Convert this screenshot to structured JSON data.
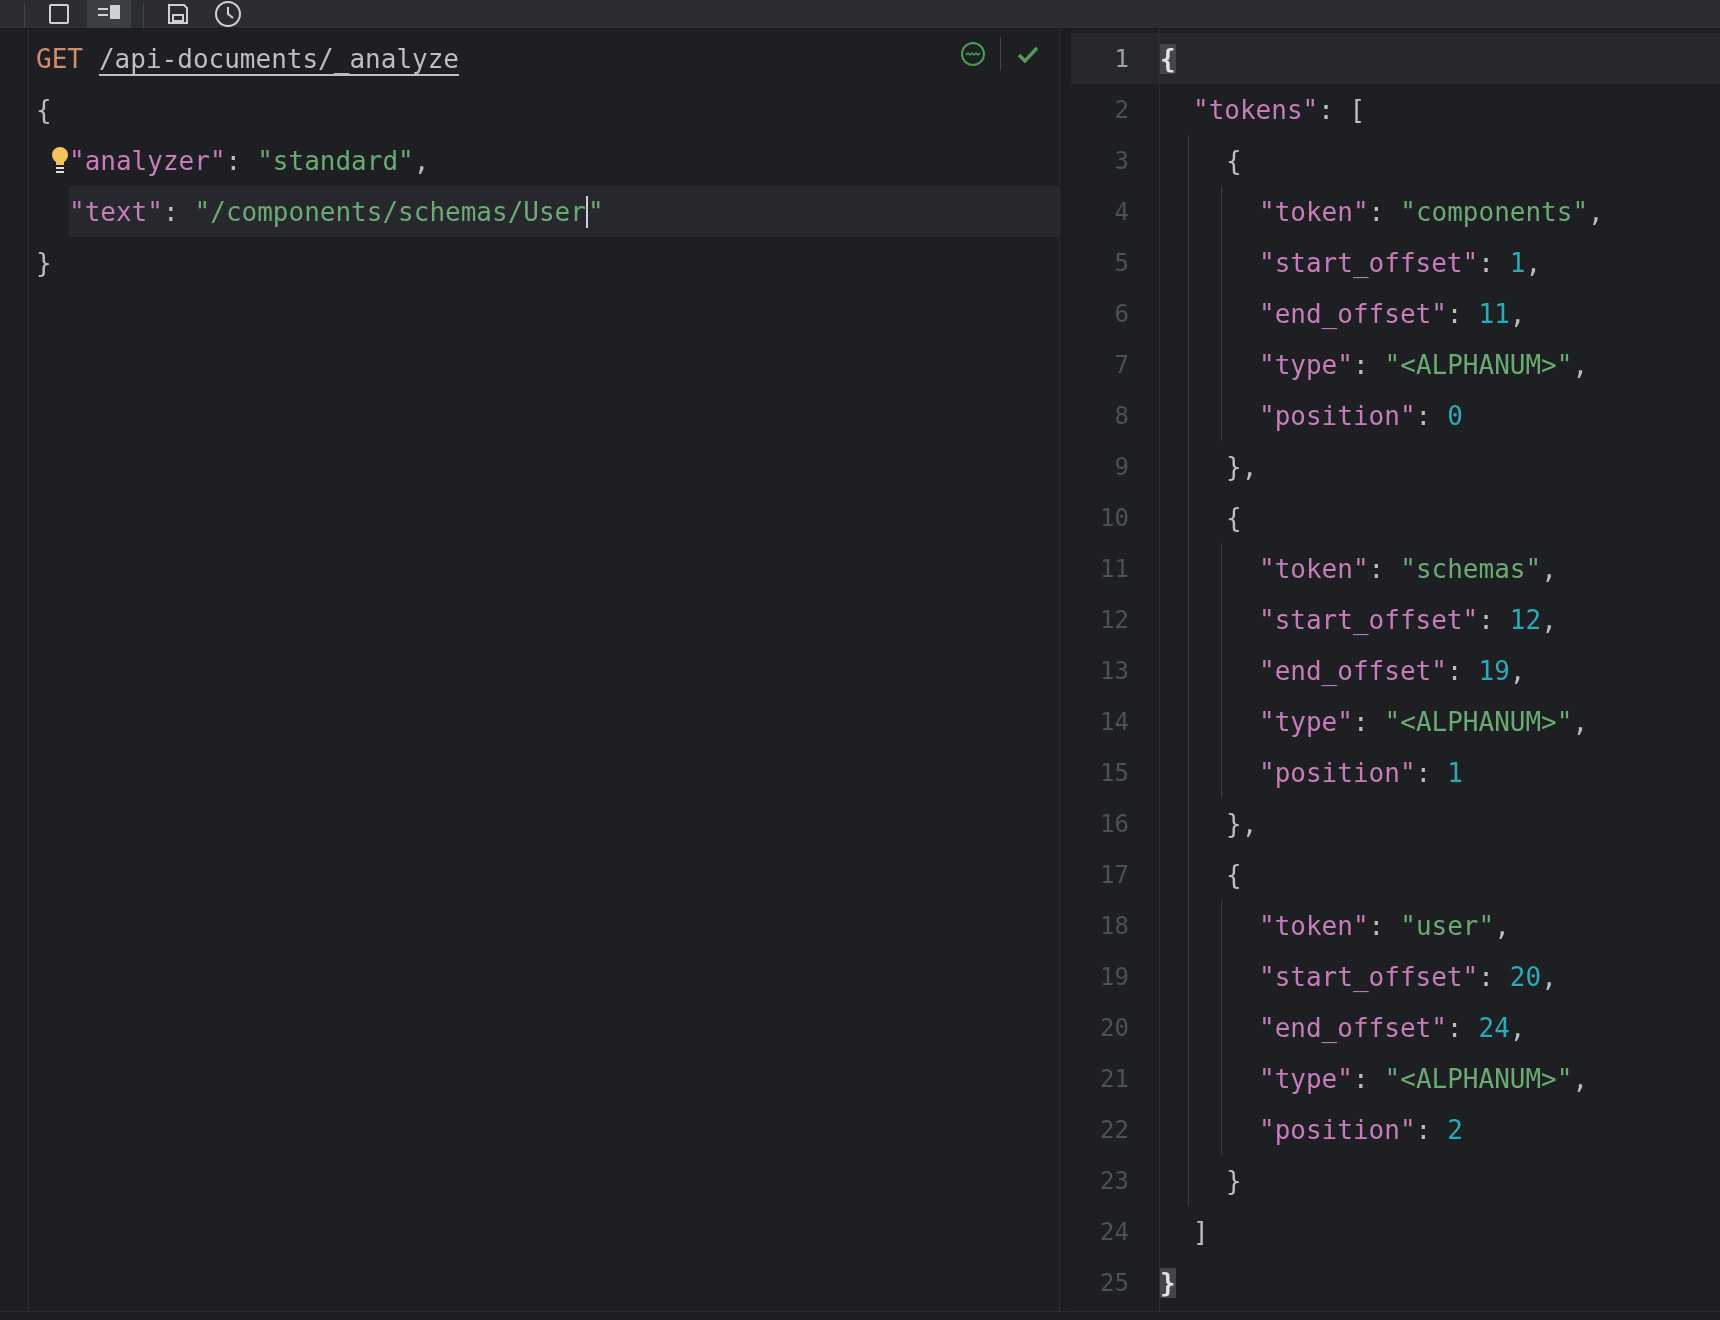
{
  "toolbar": {
    "buttons": [
      {
        "kind": "single-pane",
        "selected": false
      },
      {
        "kind": "split-pane",
        "selected": true
      },
      {
        "kind": "save",
        "selected": false
      },
      {
        "kind": "history",
        "selected": false
      }
    ]
  },
  "request_editor": {
    "status": {
      "valid": true
    },
    "lines": [
      {
        "current": false,
        "hint_bulb": false,
        "tokens": [
          {
            "kind": "method",
            "text": "GET"
          },
          {
            "kind": "url",
            "text": "/api-documents/_analyze"
          }
        ]
      },
      {
        "current": false,
        "hint_bulb": false,
        "tokens": [
          {
            "kind": "punct",
            "text": "{"
          }
        ],
        "children": [
          {
            "current": false,
            "hint_bulb": true,
            "tokens": [
              {
                "kind": "key",
                "text": "\"analyzer\""
              },
              {
                "kind": "punct",
                "text": ":"
              },
              {
                "kind": "string",
                "text": "\"standard\""
              },
              {
                "kind": "punct",
                "text": ","
              }
            ]
          },
          {
            "current": true,
            "hint_bulb": false,
            "tokens": [
              {
                "kind": "key",
                "text": "\"text\""
              },
              {
                "kind": "punct",
                "text": ":"
              },
              {
                "kind": "string",
                "text": "\"/components/schemas/User"
              },
              {
                "kind": "caret"
              },
              {
                "kind": "string",
                "text": "\""
              }
            ]
          }
        ]
      },
      {
        "current": false,
        "hint_bulb": false,
        "tokens": [
          {
            "kind": "punct",
            "text": "}"
          }
        ]
      }
    ]
  },
  "response_viewer": {
    "lines": [
      {
        "number": "1",
        "current": true,
        "tokens": [
          {
            "kind": "brace_match",
            "text": "{"
          }
        ],
        "children": [
          {
            "number": "2",
            "current": false,
            "tokens": [
              {
                "kind": "key",
                "text": "\"tokens\""
              },
              {
                "kind": "punct",
                "text": ": ["
              }
            ],
            "children": [
              {
                "number": "3",
                "current": false,
                "tokens": [
                  {
                    "kind": "punct",
                    "text": "{"
                  }
                ],
                "children": [
                  {
                    "number": "4",
                    "current": false,
                    "tokens": [
                      {
                        "kind": "key",
                        "text": "\"token\""
                      },
                      {
                        "kind": "punct",
                        "text": ":"
                      },
                      {
                        "kind": "string",
                        "text": "\"components\""
                      },
                      {
                        "kind": "punct",
                        "text": ","
                      }
                    ]
                  },
                  {
                    "number": "5",
                    "current": false,
                    "tokens": [
                      {
                        "kind": "key",
                        "text": "\"start_offset\""
                      },
                      {
                        "kind": "punct",
                        "text": ":"
                      },
                      {
                        "kind": "number",
                        "text": "1"
                      },
                      {
                        "kind": "punct",
                        "text": ","
                      }
                    ]
                  },
                  {
                    "number": "6",
                    "current": false,
                    "tokens": [
                      {
                        "kind": "key",
                        "text": "\"end_offset\""
                      },
                      {
                        "kind": "punct",
                        "text": ":"
                      },
                      {
                        "kind": "number",
                        "text": "11"
                      },
                      {
                        "kind": "punct",
                        "text": ","
                      }
                    ]
                  },
                  {
                    "number": "7",
                    "current": false,
                    "tokens": [
                      {
                        "kind": "key",
                        "text": "\"type\""
                      },
                      {
                        "kind": "punct",
                        "text": ":"
                      },
                      {
                        "kind": "string",
                        "text": "\"<ALPHANUM>\""
                      },
                      {
                        "kind": "punct",
                        "text": ","
                      }
                    ]
                  },
                  {
                    "number": "8",
                    "current": false,
                    "tokens": [
                      {
                        "kind": "key",
                        "text": "\"position\""
                      },
                      {
                        "kind": "punct",
                        "text": ":"
                      },
                      {
                        "kind": "number",
                        "text": "0"
                      }
                    ]
                  }
                ]
              },
              {
                "number": "9",
                "current": false,
                "tokens": [
                  {
                    "kind": "punct",
                    "text": "},"
                  }
                ]
              },
              {
                "number": "10",
                "current": false,
                "tokens": [
                  {
                    "kind": "punct",
                    "text": "{"
                  }
                ],
                "children": [
                  {
                    "number": "11",
                    "current": false,
                    "tokens": [
                      {
                        "kind": "key",
                        "text": "\"token\""
                      },
                      {
                        "kind": "punct",
                        "text": ":"
                      },
                      {
                        "kind": "string",
                        "text": "\"schemas\""
                      },
                      {
                        "kind": "punct",
                        "text": ","
                      }
                    ]
                  },
                  {
                    "number": "12",
                    "current": false,
                    "tokens": [
                      {
                        "kind": "key",
                        "text": "\"start_offset\""
                      },
                      {
                        "kind": "punct",
                        "text": ":"
                      },
                      {
                        "kind": "number",
                        "text": "12"
                      },
                      {
                        "kind": "punct",
                        "text": ","
                      }
                    ]
                  },
                  {
                    "number": "13",
                    "current": false,
                    "tokens": [
                      {
                        "kind": "key",
                        "text": "\"end_offset\""
                      },
                      {
                        "kind": "punct",
                        "text": ":"
                      },
                      {
                        "kind": "number",
                        "text": "19"
                      },
                      {
                        "kind": "punct",
                        "text": ","
                      }
                    ]
                  },
                  {
                    "number": "14",
                    "current": false,
                    "tokens": [
                      {
                        "kind": "key",
                        "text": "\"type\""
                      },
                      {
                        "kind": "punct",
                        "text": ":"
                      },
                      {
                        "kind": "string",
                        "text": "\"<ALPHANUM>\""
                      },
                      {
                        "kind": "punct",
                        "text": ","
                      }
                    ]
                  },
                  {
                    "number": "15",
                    "current": false,
                    "tokens": [
                      {
                        "kind": "key",
                        "text": "\"position\""
                      },
                      {
                        "kind": "punct",
                        "text": ":"
                      },
                      {
                        "kind": "number",
                        "text": "1"
                      }
                    ]
                  }
                ]
              },
              {
                "number": "16",
                "current": false,
                "tokens": [
                  {
                    "kind": "punct",
                    "text": "},"
                  }
                ]
              },
              {
                "number": "17",
                "current": false,
                "tokens": [
                  {
                    "kind": "punct",
                    "text": "{"
                  }
                ],
                "children": [
                  {
                    "number": "18",
                    "current": false,
                    "tokens": [
                      {
                        "kind": "key",
                        "text": "\"token\""
                      },
                      {
                        "kind": "punct",
                        "text": ":"
                      },
                      {
                        "kind": "string",
                        "text": "\"user\""
                      },
                      {
                        "kind": "punct",
                        "text": ","
                      }
                    ]
                  },
                  {
                    "number": "19",
                    "current": false,
                    "tokens": [
                      {
                        "kind": "key",
                        "text": "\"start_offset\""
                      },
                      {
                        "kind": "punct",
                        "text": ":"
                      },
                      {
                        "kind": "number",
                        "text": "20"
                      },
                      {
                        "kind": "punct",
                        "text": ","
                      }
                    ]
                  },
                  {
                    "number": "20",
                    "current": false,
                    "tokens": [
                      {
                        "kind": "key",
                        "text": "\"end_offset\""
                      },
                      {
                        "kind": "punct",
                        "text": ":"
                      },
                      {
                        "kind": "number",
                        "text": "24"
                      },
                      {
                        "kind": "punct",
                        "text": ","
                      }
                    ]
                  },
                  {
                    "number": "21",
                    "current": false,
                    "tokens": [
                      {
                        "kind": "key",
                        "text": "\"type\""
                      },
                      {
                        "kind": "punct",
                        "text": ":"
                      },
                      {
                        "kind": "string",
                        "text": "\"<ALPHANUM>\""
                      },
                      {
                        "kind": "punct",
                        "text": ","
                      }
                    ]
                  },
                  {
                    "number": "22",
                    "current": false,
                    "tokens": [
                      {
                        "kind": "key",
                        "text": "\"position\""
                      },
                      {
                        "kind": "punct",
                        "text": ":"
                      },
                      {
                        "kind": "number",
                        "text": "2"
                      }
                    ]
                  }
                ]
              },
              {
                "number": "23",
                "current": false,
                "tokens": [
                  {
                    "kind": "punct",
                    "text": "}"
                  }
                ]
              }
            ]
          },
          {
            "number": "24",
            "current": false,
            "tokens": [
              {
                "kind": "punct",
                "text": "]"
              }
            ]
          }
        ]
      },
      {
        "number": "25",
        "current": false,
        "tokens": [
          {
            "kind": "brace_match",
            "text": "}"
          }
        ]
      }
    ]
  }
}
